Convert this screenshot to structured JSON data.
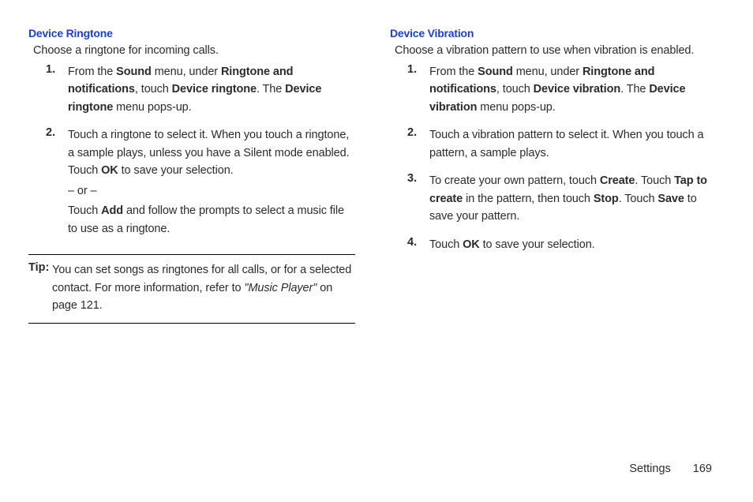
{
  "left": {
    "heading": "Device Ringtone",
    "intro": "Choose a ringtone for incoming calls.",
    "items": [
      {
        "num": "1.",
        "parts": [
          "From the ",
          "Sound",
          " menu, under ",
          "Ringtone and notifications",
          ", touch ",
          "Device ringtone",
          ". The ",
          "Device ringtone",
          " menu pops-up."
        ]
      },
      {
        "num": "2.",
        "line1": [
          "Touch a ringtone to select it. When you touch a ringtone, a sample plays, unless you have a Silent mode enabled. Touch ",
          "OK",
          " to save your selection."
        ],
        "or": "– or –",
        "line2": [
          "Touch ",
          "Add",
          " and follow the prompts to select a music file to use as a ringtone."
        ]
      }
    ],
    "tip": {
      "label": "Tip:",
      "parts": [
        "You can set songs as ringtones for all calls, or for a selected contact. For more information, refer to ",
        "\"Music Player\"",
        "  on page 121."
      ]
    }
  },
  "right": {
    "heading": "Device Vibration",
    "intro": "Choose a vibration pattern to use when vibration is enabled.",
    "items": [
      {
        "num": "1.",
        "parts": [
          "From the ",
          "Sound",
          " menu, under ",
          "Ringtone and notifications",
          ", touch ",
          "Device vibration",
          ". The ",
          "Device vibration",
          " menu pops-up."
        ]
      },
      {
        "num": "2.",
        "parts": [
          "Touch a vibration pattern to select it. When you touch a pattern, a sample plays."
        ]
      },
      {
        "num": "3.",
        "parts": [
          "To create your own pattern, touch ",
          "Create",
          ". Touch ",
          "Tap to create",
          " in the pattern, then touch ",
          "Stop",
          ". Touch ",
          "Save",
          " to save your pattern."
        ]
      },
      {
        "num": "4.",
        "parts": [
          "Touch ",
          "OK",
          " to save your selection."
        ]
      }
    ]
  },
  "footer": {
    "section": "Settings",
    "page": "169"
  }
}
